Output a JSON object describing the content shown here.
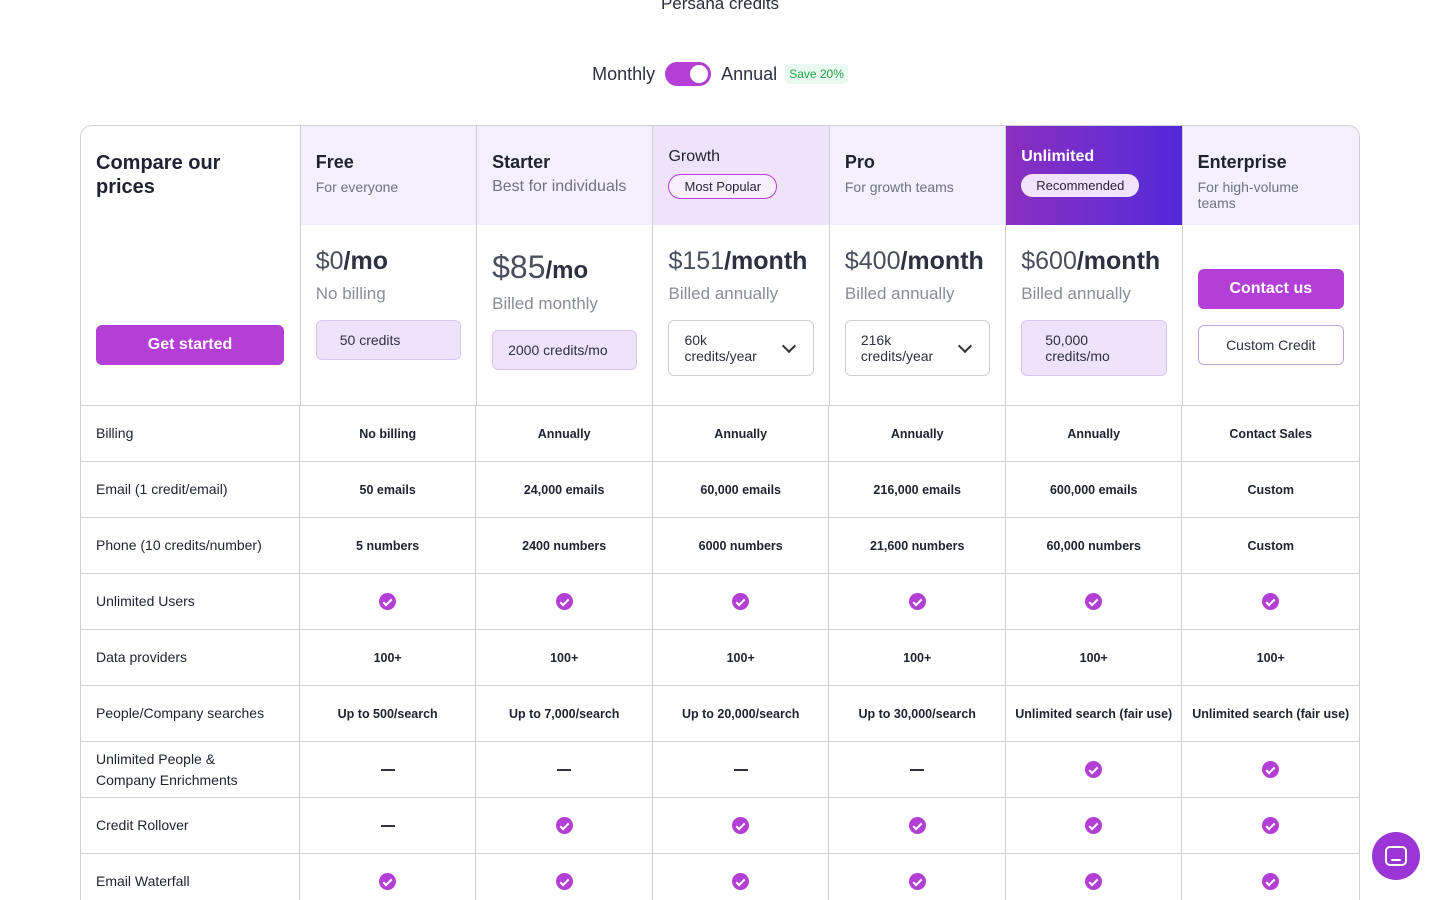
{
  "header": {
    "title": "Persana credits"
  },
  "billing_toggle": {
    "monthly_label": "Monthly",
    "annual_label": "Annual",
    "save_badge": "Save 20%",
    "selected": "Annual"
  },
  "compare": {
    "title": "Compare our prices",
    "cta": "Get started"
  },
  "plans": [
    {
      "name": "Free",
      "subtitle": "For everyone",
      "price": "$0",
      "unit": "/mo",
      "billed": "No billing",
      "credits": "50 credits"
    },
    {
      "name": "Starter",
      "subtitle": "Best for individuals",
      "price": "$85",
      "unit": "/mo",
      "billed": "Billed monthly",
      "credits": "2000 credits/mo"
    },
    {
      "name": "Growth",
      "badge": "Most Popular",
      "price": "$151",
      "unit": "/month",
      "billed": "Billed annually",
      "credits_line1": "60k",
      "credits_line2": "credits/year"
    },
    {
      "name": "Pro",
      "subtitle": "For growth teams",
      "price": "$400",
      "unit": "/month",
      "billed": "Billed annually",
      "credits_line1": "216k",
      "credits_line2": "credits/year"
    },
    {
      "name": "Unlimited",
      "badge": "Recommended",
      "price": "$600",
      "unit": "/month",
      "billed": "Billed annually",
      "credits_line1": "50,000",
      "credits_line2": "credits/mo"
    },
    {
      "name": "Enterprise",
      "subtitle_line1": "For high-volume",
      "subtitle_line2": "teams",
      "cta": "Contact us",
      "credits": "Custom Credit"
    }
  ],
  "features": [
    {
      "label": "Billing",
      "values": [
        "No billing",
        "Annually",
        "Annually",
        "Annually",
        "Annually",
        "Contact Sales"
      ]
    },
    {
      "label": "Email (1 credit/email)",
      "values": [
        "50 emails",
        "24,000 emails",
        "60,000 emails",
        "216,000 emails",
        "600,000 emails",
        "Custom"
      ]
    },
    {
      "label": "Phone (10 credits/number)",
      "values": [
        "5 numbers",
        "2400 numbers",
        "6000 numbers",
        "21,600 numbers",
        "60,000 numbers",
        "Custom"
      ]
    },
    {
      "label": "Unlimited Users",
      "values": [
        "check",
        "check",
        "check",
        "check",
        "check",
        "check"
      ]
    },
    {
      "label": "Data providers",
      "values": [
        "100+",
        "100+",
        "100+",
        "100+",
        "100+",
        "100+"
      ]
    },
    {
      "label": "People/Company searches",
      "values": [
        "Up to 500/search",
        "Up to 7,000/search",
        "Up to 20,000/search",
        "Up to 30,000/search",
        "Unlimited search (fair use)",
        "Unlimited search (fair use)"
      ]
    },
    {
      "label_line1": "Unlimited People &",
      "label_line2": "Company Enrichments",
      "values": [
        "dash",
        "dash",
        "dash",
        "dash",
        "check",
        "check"
      ]
    },
    {
      "label": "Credit Rollover",
      "values": [
        "dash",
        "check",
        "check",
        "check",
        "check",
        "check"
      ]
    },
    {
      "label": "Email Waterfall",
      "values": [
        "check",
        "check",
        "check",
        "check",
        "check",
        "check"
      ]
    }
  ],
  "chat": {
    "icon": "chat-icon"
  }
}
